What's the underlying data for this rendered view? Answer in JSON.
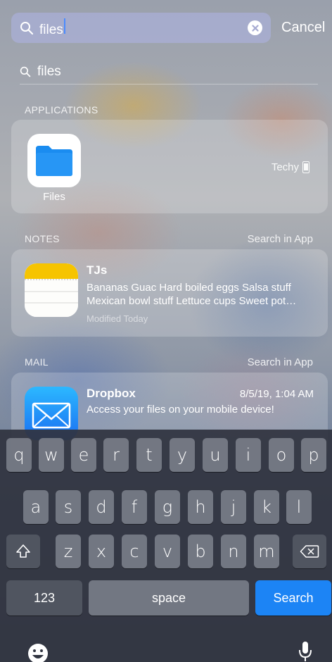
{
  "search": {
    "query": "files",
    "cancel_label": "Cancel",
    "suggestion": "files"
  },
  "applications": {
    "header": "APPLICATIONS",
    "app_name": "Files",
    "device_label": "Techy"
  },
  "notes": {
    "header": "NOTES",
    "action": "Search in App",
    "title": "TJs",
    "line1": "Bananas Guac Hard boiled eggs Salsa stuff",
    "line2": "Mexican bowl stuff Lettuce cups Sweet pot…",
    "meta": "Modified Today"
  },
  "mail": {
    "header": "MAIL",
    "action": "Search in App",
    "sender": "Dropbox",
    "date": "8/5/19, 1:04 AM",
    "subject": "Access your files on your mobile device!"
  },
  "keyboard": {
    "row1": [
      "q",
      "w",
      "e",
      "r",
      "t",
      "y",
      "u",
      "i",
      "o",
      "p"
    ],
    "row2": [
      "a",
      "s",
      "d",
      "f",
      "g",
      "h",
      "j",
      "k",
      "l"
    ],
    "row3": [
      "z",
      "x",
      "c",
      "v",
      "b",
      "n",
      "m"
    ],
    "numbers_label": "123",
    "space_label": "space",
    "search_label": "Search"
  },
  "colors": {
    "accent": "#1c84f5",
    "files_blue": "#1a8cf0",
    "notes_yellow": "#f6c400"
  }
}
